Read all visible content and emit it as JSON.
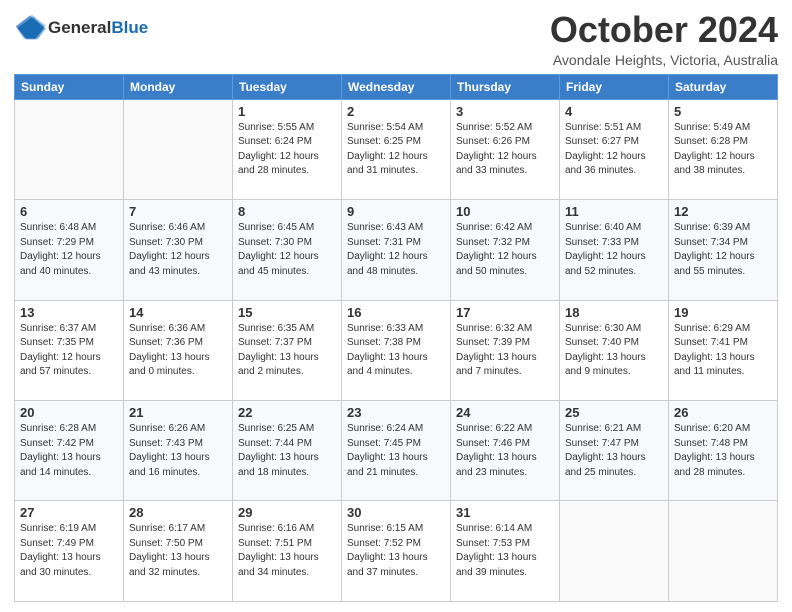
{
  "header": {
    "logo_line1": "General",
    "logo_line2": "Blue",
    "month_title": "October 2024",
    "subtitle": "Avondale Heights, Victoria, Australia"
  },
  "weekdays": [
    "Sunday",
    "Monday",
    "Tuesday",
    "Wednesday",
    "Thursday",
    "Friday",
    "Saturday"
  ],
  "weeks": [
    [
      {
        "day": "",
        "sunrise": "",
        "sunset": "",
        "daylight": ""
      },
      {
        "day": "",
        "sunrise": "",
        "sunset": "",
        "daylight": ""
      },
      {
        "day": "1",
        "sunrise": "Sunrise: 5:55 AM",
        "sunset": "Sunset: 6:24 PM",
        "daylight": "Daylight: 12 hours and 28 minutes."
      },
      {
        "day": "2",
        "sunrise": "Sunrise: 5:54 AM",
        "sunset": "Sunset: 6:25 PM",
        "daylight": "Daylight: 12 hours and 31 minutes."
      },
      {
        "day": "3",
        "sunrise": "Sunrise: 5:52 AM",
        "sunset": "Sunset: 6:26 PM",
        "daylight": "Daylight: 12 hours and 33 minutes."
      },
      {
        "day": "4",
        "sunrise": "Sunrise: 5:51 AM",
        "sunset": "Sunset: 6:27 PM",
        "daylight": "Daylight: 12 hours and 36 minutes."
      },
      {
        "day": "5",
        "sunrise": "Sunrise: 5:49 AM",
        "sunset": "Sunset: 6:28 PM",
        "daylight": "Daylight: 12 hours and 38 minutes."
      }
    ],
    [
      {
        "day": "6",
        "sunrise": "Sunrise: 6:48 AM",
        "sunset": "Sunset: 7:29 PM",
        "daylight": "Daylight: 12 hours and 40 minutes."
      },
      {
        "day": "7",
        "sunrise": "Sunrise: 6:46 AM",
        "sunset": "Sunset: 7:30 PM",
        "daylight": "Daylight: 12 hours and 43 minutes."
      },
      {
        "day": "8",
        "sunrise": "Sunrise: 6:45 AM",
        "sunset": "Sunset: 7:30 PM",
        "daylight": "Daylight: 12 hours and 45 minutes."
      },
      {
        "day": "9",
        "sunrise": "Sunrise: 6:43 AM",
        "sunset": "Sunset: 7:31 PM",
        "daylight": "Daylight: 12 hours and 48 minutes."
      },
      {
        "day": "10",
        "sunrise": "Sunrise: 6:42 AM",
        "sunset": "Sunset: 7:32 PM",
        "daylight": "Daylight: 12 hours and 50 minutes."
      },
      {
        "day": "11",
        "sunrise": "Sunrise: 6:40 AM",
        "sunset": "Sunset: 7:33 PM",
        "daylight": "Daylight: 12 hours and 52 minutes."
      },
      {
        "day": "12",
        "sunrise": "Sunrise: 6:39 AM",
        "sunset": "Sunset: 7:34 PM",
        "daylight": "Daylight: 12 hours and 55 minutes."
      }
    ],
    [
      {
        "day": "13",
        "sunrise": "Sunrise: 6:37 AM",
        "sunset": "Sunset: 7:35 PM",
        "daylight": "Daylight: 12 hours and 57 minutes."
      },
      {
        "day": "14",
        "sunrise": "Sunrise: 6:36 AM",
        "sunset": "Sunset: 7:36 PM",
        "daylight": "Daylight: 13 hours and 0 minutes."
      },
      {
        "day": "15",
        "sunrise": "Sunrise: 6:35 AM",
        "sunset": "Sunset: 7:37 PM",
        "daylight": "Daylight: 13 hours and 2 minutes."
      },
      {
        "day": "16",
        "sunrise": "Sunrise: 6:33 AM",
        "sunset": "Sunset: 7:38 PM",
        "daylight": "Daylight: 13 hours and 4 minutes."
      },
      {
        "day": "17",
        "sunrise": "Sunrise: 6:32 AM",
        "sunset": "Sunset: 7:39 PM",
        "daylight": "Daylight: 13 hours and 7 minutes."
      },
      {
        "day": "18",
        "sunrise": "Sunrise: 6:30 AM",
        "sunset": "Sunset: 7:40 PM",
        "daylight": "Daylight: 13 hours and 9 minutes."
      },
      {
        "day": "19",
        "sunrise": "Sunrise: 6:29 AM",
        "sunset": "Sunset: 7:41 PM",
        "daylight": "Daylight: 13 hours and 11 minutes."
      }
    ],
    [
      {
        "day": "20",
        "sunrise": "Sunrise: 6:28 AM",
        "sunset": "Sunset: 7:42 PM",
        "daylight": "Daylight: 13 hours and 14 minutes."
      },
      {
        "day": "21",
        "sunrise": "Sunrise: 6:26 AM",
        "sunset": "Sunset: 7:43 PM",
        "daylight": "Daylight: 13 hours and 16 minutes."
      },
      {
        "day": "22",
        "sunrise": "Sunrise: 6:25 AM",
        "sunset": "Sunset: 7:44 PM",
        "daylight": "Daylight: 13 hours and 18 minutes."
      },
      {
        "day": "23",
        "sunrise": "Sunrise: 6:24 AM",
        "sunset": "Sunset: 7:45 PM",
        "daylight": "Daylight: 13 hours and 21 minutes."
      },
      {
        "day": "24",
        "sunrise": "Sunrise: 6:22 AM",
        "sunset": "Sunset: 7:46 PM",
        "daylight": "Daylight: 13 hours and 23 minutes."
      },
      {
        "day": "25",
        "sunrise": "Sunrise: 6:21 AM",
        "sunset": "Sunset: 7:47 PM",
        "daylight": "Daylight: 13 hours and 25 minutes."
      },
      {
        "day": "26",
        "sunrise": "Sunrise: 6:20 AM",
        "sunset": "Sunset: 7:48 PM",
        "daylight": "Daylight: 13 hours and 28 minutes."
      }
    ],
    [
      {
        "day": "27",
        "sunrise": "Sunrise: 6:19 AM",
        "sunset": "Sunset: 7:49 PM",
        "daylight": "Daylight: 13 hours and 30 minutes."
      },
      {
        "day": "28",
        "sunrise": "Sunrise: 6:17 AM",
        "sunset": "Sunset: 7:50 PM",
        "daylight": "Daylight: 13 hours and 32 minutes."
      },
      {
        "day": "29",
        "sunrise": "Sunrise: 6:16 AM",
        "sunset": "Sunset: 7:51 PM",
        "daylight": "Daylight: 13 hours and 34 minutes."
      },
      {
        "day": "30",
        "sunrise": "Sunrise: 6:15 AM",
        "sunset": "Sunset: 7:52 PM",
        "daylight": "Daylight: 13 hours and 37 minutes."
      },
      {
        "day": "31",
        "sunrise": "Sunrise: 6:14 AM",
        "sunset": "Sunset: 7:53 PM",
        "daylight": "Daylight: 13 hours and 39 minutes."
      },
      {
        "day": "",
        "sunrise": "",
        "sunset": "",
        "daylight": ""
      },
      {
        "day": "",
        "sunrise": "",
        "sunset": "",
        "daylight": ""
      }
    ]
  ]
}
